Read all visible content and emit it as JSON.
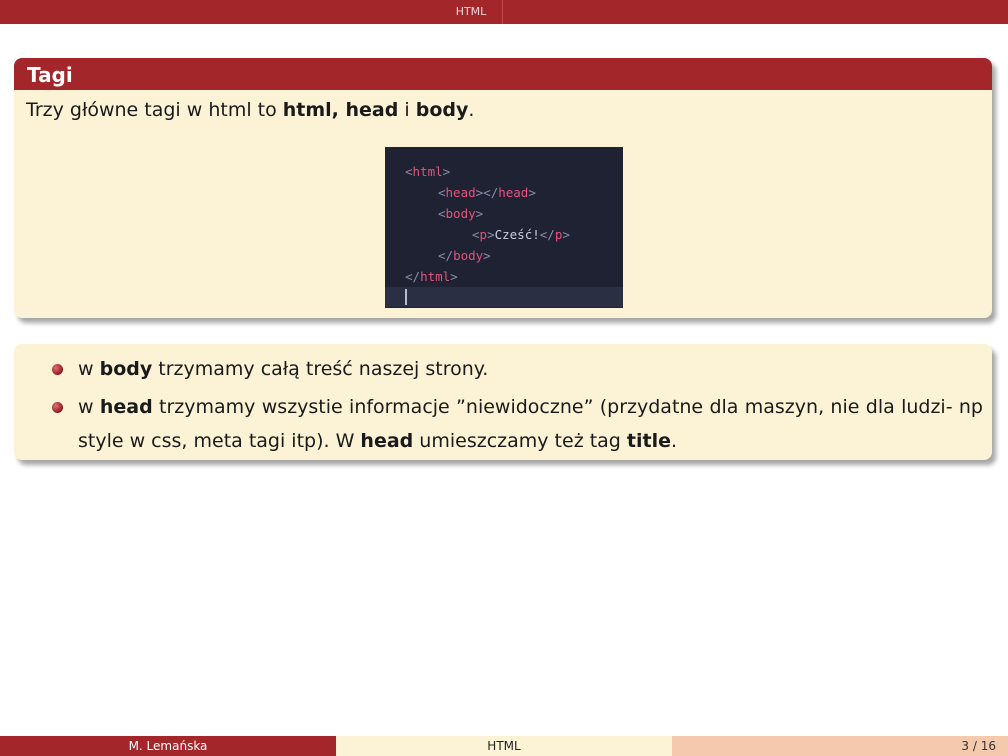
{
  "header": {
    "nav_title": "HTML"
  },
  "block_tags": {
    "title": "Tagi",
    "intro_pre": "Trzy główne tagi w html to ",
    "intro_bold1": "html, head",
    "intro_mid": " i ",
    "intro_bold2": "body",
    "intro_post": "."
  },
  "code_snippet": {
    "l1_open": "<",
    "l1_tag": "html",
    "l1_close": ">",
    "l2_a": "<",
    "l2_tag": "head",
    "l2_b": "></",
    "l2_tag2": "head",
    "l2_c": ">",
    "l3_a": "<",
    "l3_tag": "body",
    "l3_b": ">",
    "l4_a": "<",
    "l4_tag": "p",
    "l4_b": ">",
    "l4_text": "Cześć!",
    "l4_c": "</",
    "l4_tag2": "p",
    "l4_d": ">",
    "l5_a": "</",
    "l5_tag": "body",
    "l5_b": ">",
    "l6_a": "</",
    "l6_tag": "html",
    "l6_b": ">"
  },
  "bullets": {
    "b1_pre": "w ",
    "b1_bold": "body",
    "b1_post": " trzymamy całą treść naszej strony.",
    "b2_pre": "w ",
    "b2_bold": "head",
    "b2_mid": " trzymamy wszystie informacje ”niewidoczne” (przydatne dla maszyn, nie dla ludzi- np style w css, meta tagi itp). W ",
    "b2_bold2": "head",
    "b2_mid2": " umieszczamy też tag ",
    "b2_bold3": "title",
    "b2_post": "."
  },
  "footer": {
    "author": "M. Lemańska",
    "title": "HTML",
    "page": "3 / 16"
  },
  "colors": {
    "accent": "#a3262b",
    "block_bg": "#fcf3d6",
    "footer_right": "#f5c9ae",
    "code_bg": "#1f2233",
    "code_tag": "#e8527b"
  }
}
